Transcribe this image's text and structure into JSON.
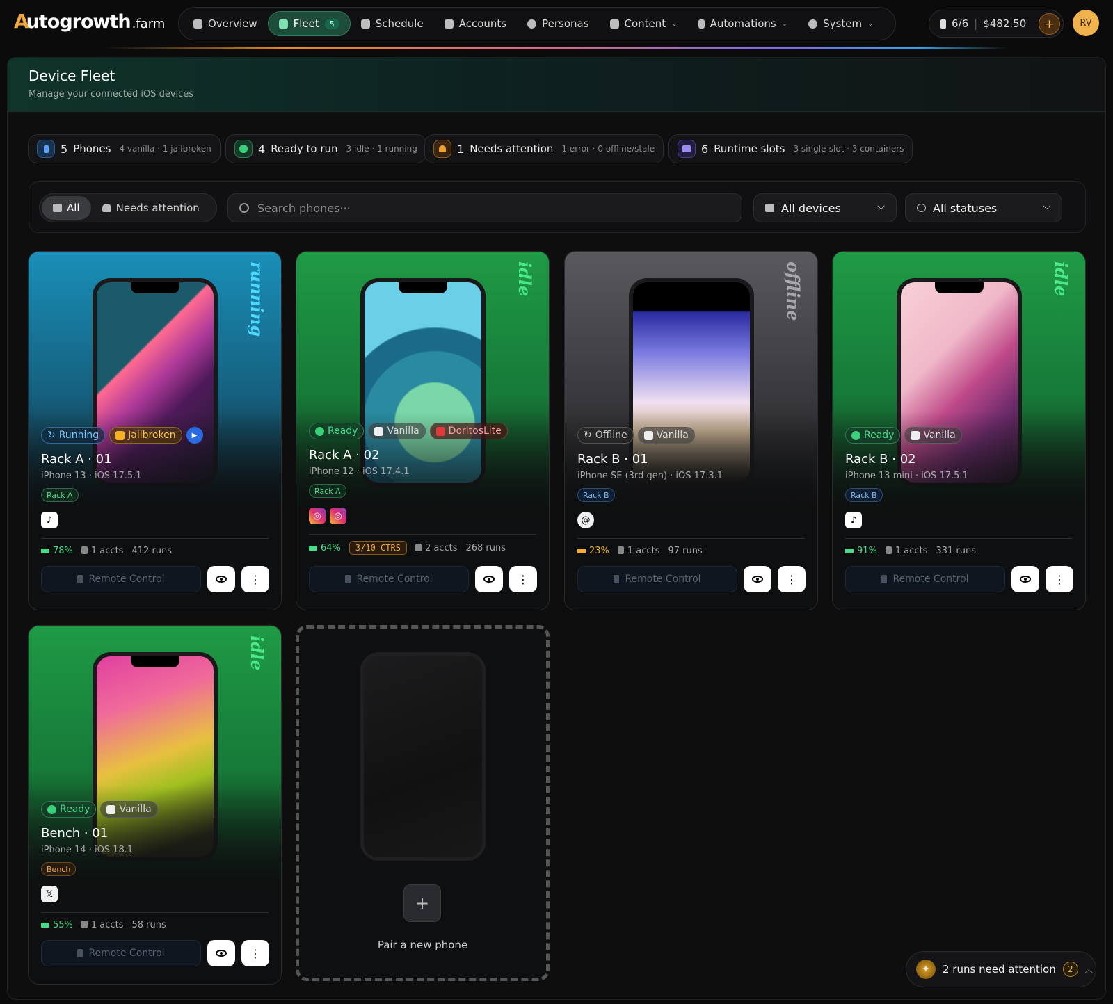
{
  "brand": {
    "mark": "A",
    "name": "utogrowth",
    "tld": ".farm"
  },
  "nav": [
    {
      "label": "Overview",
      "icon": "grid-icon"
    },
    {
      "label": "Fleet",
      "icon": "phones-icon",
      "badge": "5",
      "active": true
    },
    {
      "label": "Schedule",
      "icon": "calendar-icon"
    },
    {
      "label": "Accounts",
      "icon": "id-card-icon"
    },
    {
      "label": "Personas",
      "icon": "person-icon"
    },
    {
      "label": "Content",
      "icon": "document-icon",
      "chevron": "⌄"
    },
    {
      "label": "Automations",
      "icon": "bolt-icon",
      "chevron": "⌄"
    },
    {
      "label": "System",
      "icon": "gear-icon",
      "chevron": "⌄"
    }
  ],
  "credits": {
    "devices": "6/6",
    "balance": "$482.50",
    "add": "+"
  },
  "user": {
    "initials": "RV"
  },
  "page": {
    "title": "Device Fleet",
    "subtitle": "Manage your connected iOS devices"
  },
  "stats": [
    {
      "num": "5",
      "label": "Phones",
      "sub": "4 vanilla · 1 jailbroken",
      "color": "#3a7ad8"
    },
    {
      "num": "4",
      "label": "Ready to run",
      "sub": "3 idle · 1 running",
      "color": "#2aa860"
    },
    {
      "num": "1",
      "label": "Needs attention",
      "sub": "1 error · 0 offline/stale",
      "color": "#d8902a"
    },
    {
      "num": "6",
      "label": "Runtime slots",
      "sub": "3 single-slot · 3 containers",
      "color": "#7a6ae0"
    }
  ],
  "filters": {
    "seg_all": "All",
    "seg_attention": "Needs attention",
    "search_placeholder": "Search phones···",
    "devices": "All devices",
    "statuses": "All statuses"
  },
  "cards": [
    {
      "status_word": "running",
      "word_color": "#4fd8ff",
      "chips": [
        "Running",
        "Jailbroken"
      ],
      "name": "Rack A · 01",
      "model": "iPhone 13 · iOS 17.5.1",
      "rack": "Rack A",
      "apps": [
        "tiktok"
      ],
      "battery": "78%",
      "battery_color": "#4ad88a",
      "accts": "1 accts",
      "runs": "412 runs",
      "remote": "Remote Control"
    },
    {
      "status_word": "idle",
      "word_color": "#4ae88a",
      "chips": [
        "Ready",
        "Vanilla",
        "DoritosLite"
      ],
      "name": "Rack A · 02",
      "model": "iPhone 12 · iOS 17.4.1",
      "rack": "Rack A",
      "apps": [
        "instagram",
        "instagram"
      ],
      "battery": "64%",
      "battery_color": "#4ad88a",
      "ctrs": "3/10 CTRS",
      "accts": "2 accts",
      "runs": "268 runs",
      "remote": "Remote Control"
    },
    {
      "status_word": "offline",
      "word_color": "#a8a8ac",
      "chips": [
        "Offline",
        "Vanilla"
      ],
      "name": "Rack B · 01",
      "model": "iPhone SE (3rd gen) · iOS 17.3.1",
      "rack": "Rack B",
      "apps": [
        "threads"
      ],
      "battery": "23%",
      "battery_color": "#f0b030",
      "accts": "1 accts",
      "runs": "97 runs",
      "remote": "Remote Control"
    },
    {
      "status_word": "idle",
      "word_color": "#4ae88a",
      "chips": [
        "Ready",
        "Vanilla"
      ],
      "name": "Rack B · 02",
      "model": "iPhone 13 mini · iOS 17.5.1",
      "rack": "Rack B",
      "apps": [
        "tiktok"
      ],
      "battery": "91%",
      "battery_color": "#4ad88a",
      "accts": "1 accts",
      "runs": "331 runs",
      "remote": "Remote Control"
    },
    {
      "status_word": "idle",
      "word_color": "#4ae88a",
      "chips": [
        "Ready",
        "Vanilla"
      ],
      "name": "Bench · 01",
      "model": "iPhone 14 · iOS 18.1",
      "rack": "Bench",
      "apps": [
        "x"
      ],
      "battery": "55%",
      "battery_color": "#4ad88a",
      "accts": "1 accts",
      "runs": "58 runs",
      "remote": "Remote Control"
    }
  ],
  "pair": {
    "plus": "+",
    "label": "Pair a new phone"
  },
  "toast": {
    "text": "2 runs need attention",
    "count": "2",
    "caret": "︿"
  }
}
